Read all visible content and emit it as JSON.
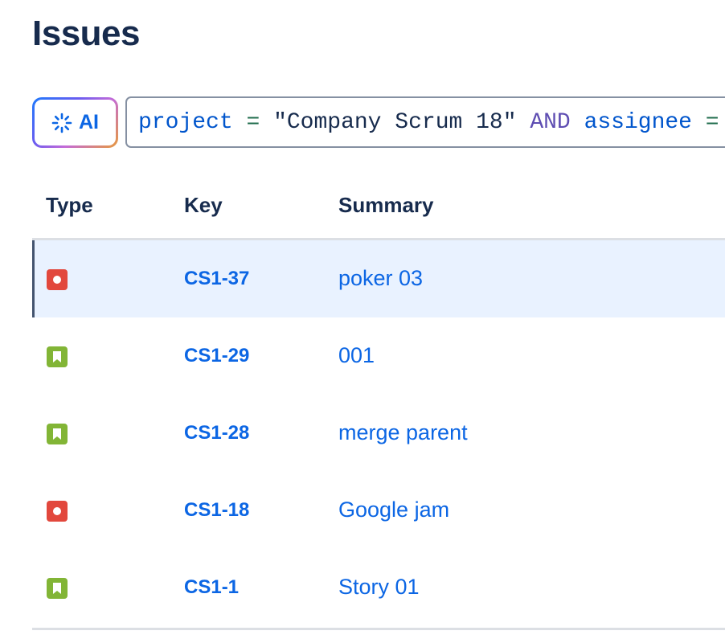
{
  "page": {
    "title": "Issues"
  },
  "search": {
    "ai_button_label": "AI",
    "ai_icon": "ai-sparkle-icon",
    "jql_tokens": [
      {
        "type": "field",
        "text": "project"
      },
      {
        "type": "op",
        "text": "="
      },
      {
        "type": "string",
        "text": "\"Company Scrum 18\""
      },
      {
        "type": "keyword",
        "text": "AND"
      },
      {
        "type": "field",
        "text": "assignee"
      },
      {
        "type": "op",
        "text": "="
      }
    ]
  },
  "table": {
    "columns": {
      "type": "Type",
      "key": "Key",
      "summary": "Summary"
    },
    "rows": [
      {
        "type": "bug",
        "type_icon": "bug-icon",
        "key": "CS1-37",
        "summary": "poker 03",
        "selected": true
      },
      {
        "type": "story",
        "type_icon": "story-icon",
        "key": "CS1-29",
        "summary": "001",
        "selected": false
      },
      {
        "type": "story",
        "type_icon": "story-icon",
        "key": "CS1-28",
        "summary": "merge parent",
        "selected": false
      },
      {
        "type": "bug",
        "type_icon": "bug-icon",
        "key": "CS1-18",
        "summary": "Google jam",
        "selected": false
      },
      {
        "type": "story",
        "type_icon": "story-icon",
        "key": "CS1-1",
        "summary": "Story 01",
        "selected": false
      }
    ]
  },
  "colors": {
    "link": "#0c66e4",
    "bug": "#e2483d",
    "story": "#82b536",
    "selected_row_bg": "#e9f2ff"
  }
}
